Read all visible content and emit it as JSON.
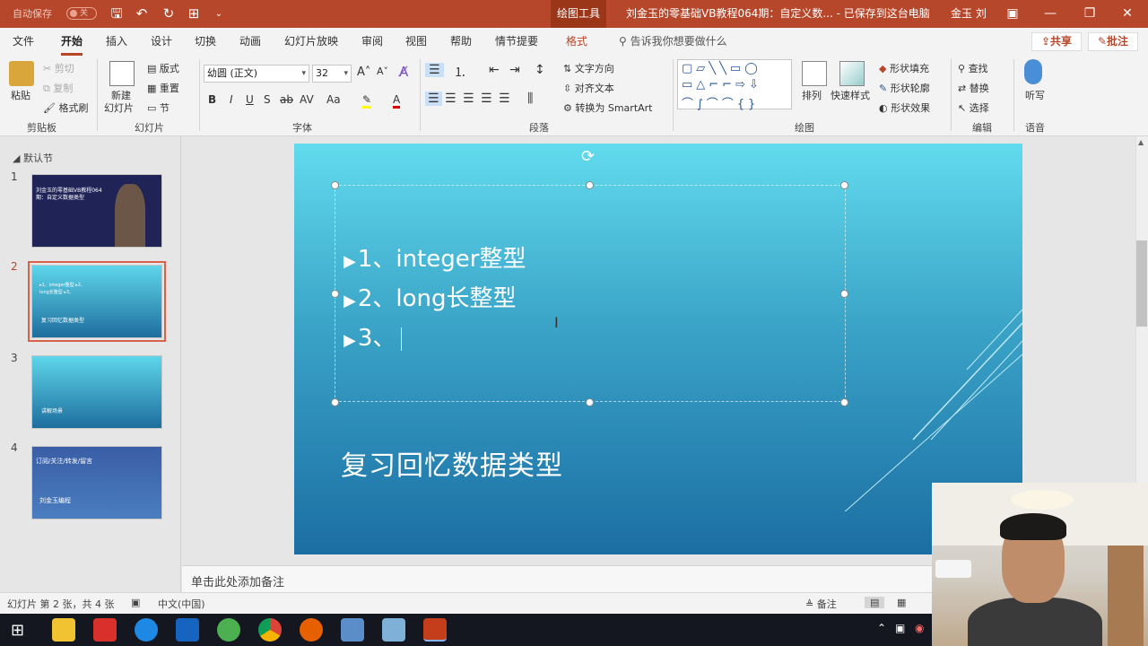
{
  "titlebar": {
    "autosave_label": "自动保存",
    "autosave_state": "关",
    "context_tab": "绘图工具",
    "doc_title": "刘金玉的零基础VB教程064期：自定义数...  -  已保存到这台电脑",
    "user": "金玉 刘"
  },
  "menu": {
    "tabs": [
      "文件",
      "开始",
      "插入",
      "设计",
      "切换",
      "动画",
      "幻灯片放映",
      "审阅",
      "视图",
      "帮助",
      "情节提要",
      "格式"
    ],
    "tell_me": "告诉我你想要做什么",
    "share": "共享",
    "comments": "批注"
  },
  "ribbon": {
    "clipboard": {
      "paste": "粘贴",
      "cut": "剪切",
      "copy": "复制",
      "format_painter": "格式刷",
      "label": "剪贴板"
    },
    "slides": {
      "new_slide": "新建",
      "new_slide2": "幻灯片",
      "layout": "版式",
      "reset": "重置",
      "section": "节",
      "label": "幻灯片"
    },
    "font": {
      "name": "幼圆 (正文)",
      "size": "32",
      "label": "字体"
    },
    "paragraph": {
      "text_direction": "文字方向",
      "align_text": "对齐文本",
      "smartart": "转换为 SmartArt",
      "label": "段落"
    },
    "drawing": {
      "arrange": "排列",
      "quick_styles": "快速样式",
      "fill": "形状填充",
      "outline": "形状轮廓",
      "effects": "形状效果",
      "label": "绘图"
    },
    "editing": {
      "find": "查找",
      "replace": "替换",
      "select": "选择",
      "label": "编辑"
    },
    "voice": {
      "dictate": "听写",
      "label": "语音"
    }
  },
  "thumbs": {
    "section": "默认节",
    "items": [
      {
        "num": "1",
        "text": "刘金玉的零基础VB教程064期：自定义数据类型"
      },
      {
        "num": "2",
        "text": "▸1、integer整型 ▸2、long长整型 ▸3、",
        "sub": "复习回忆数据类型"
      },
      {
        "num": "3",
        "text": "讲解场景"
      },
      {
        "num": "4",
        "text": "订阅/关注/转发/留言",
        "sub": "刘金玉编程"
      }
    ]
  },
  "slide": {
    "bullets": [
      "1、integer整型",
      "2、long长整型",
      "3、"
    ],
    "subtitle": "复习回忆数据类型"
  },
  "notes": {
    "placeholder": "单击此处添加备注"
  },
  "status": {
    "slide_info": "幻灯片 第 2 张，共 4 张",
    "language": "中文(中国)",
    "notes_btn": "备注"
  },
  "colors": {
    "accent": "#b7472a",
    "slide_top": "#62dbee",
    "slide_bottom": "#1b6ea3"
  }
}
